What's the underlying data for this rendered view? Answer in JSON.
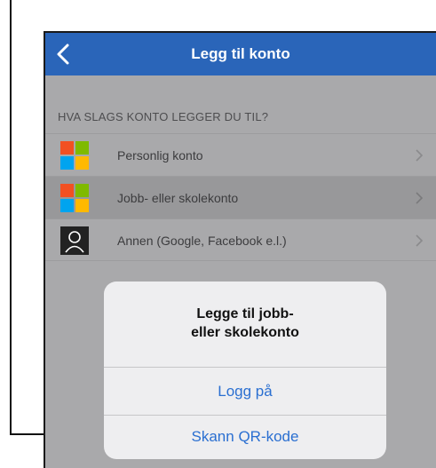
{
  "navbar": {
    "title": "Legg til konto",
    "back_icon": "chevron-left-icon"
  },
  "section": {
    "header": "HVA SLAGS KONTO LEGGER DU TIL?"
  },
  "rows": [
    {
      "label": "Personlig konto",
      "icon": "microsoft-logo-icon",
      "highlighted": false
    },
    {
      "label": "Jobb- eller skolekonto",
      "icon": "microsoft-logo-icon",
      "highlighted": true
    },
    {
      "label": "Annen (Google, Facebook e.l.)",
      "icon": "person-icon",
      "highlighted": false
    }
  ],
  "dialog": {
    "title_line1": "Legge til jobb-",
    "title_line2": "eller skolekonto",
    "buttons": [
      "Logg på",
      "Skann QR-kode"
    ]
  },
  "colors": {
    "navbar": "#2a65b9",
    "accent": "#2a6fd1",
    "ms_red": "#f25022",
    "ms_green": "#7fba00",
    "ms_blue": "#00a4ef",
    "ms_yellow": "#ffb900"
  }
}
